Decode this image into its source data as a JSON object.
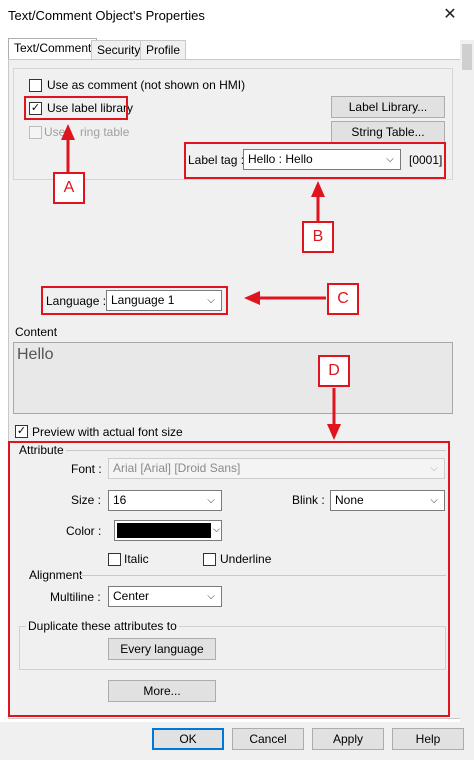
{
  "window": {
    "title": "Text/Comment Object's Properties",
    "close_glyph": "✕"
  },
  "tabs": [
    "Text/Comment",
    "Security",
    "Profile"
  ],
  "options": {
    "use_as_comment": "Use as comment (not shown on HMI)",
    "use_label_library": "Use label library",
    "use_string_table": "Use string table",
    "use_string_table_visible": "Use ",
    "use_string_table_rest": "ring table"
  },
  "buttons": {
    "label_library": "Label Library...",
    "string_table": "String Table...",
    "every_language": "Every language",
    "more": "More...",
    "ok": "OK",
    "cancel": "Cancel",
    "apply": "Apply",
    "help": "Help"
  },
  "label_tag": {
    "label": "Label tag :",
    "value": "Hello : Hello",
    "code": "[0001]"
  },
  "language": {
    "label": "Language :",
    "value": "Language 1"
  },
  "content": {
    "heading": "Content",
    "text": "Hello"
  },
  "preview": {
    "label": "Preview with actual font size"
  },
  "attribute": {
    "heading": "Attribute",
    "font_label": "Font :",
    "font_value": "Arial [Arial] [Droid Sans]",
    "size_label": "Size :",
    "size_value": "16",
    "blink_label": "Blink :",
    "blink_value": "None",
    "color_label": "Color :",
    "color_value": "#000000",
    "italic": "Italic",
    "underline": "Underline",
    "alignment_heading": "Alignment",
    "multiline_label": "Multiline :",
    "multiline_value": "Center",
    "duplicate_heading": "Duplicate these attributes to"
  },
  "callouts": [
    "A",
    "B",
    "C",
    "D"
  ],
  "colors": {
    "annotation": "#e0141e",
    "default_button_border": "#0078d7"
  },
  "checked_glyph": "✓",
  "caret_glyph": "⌵"
}
